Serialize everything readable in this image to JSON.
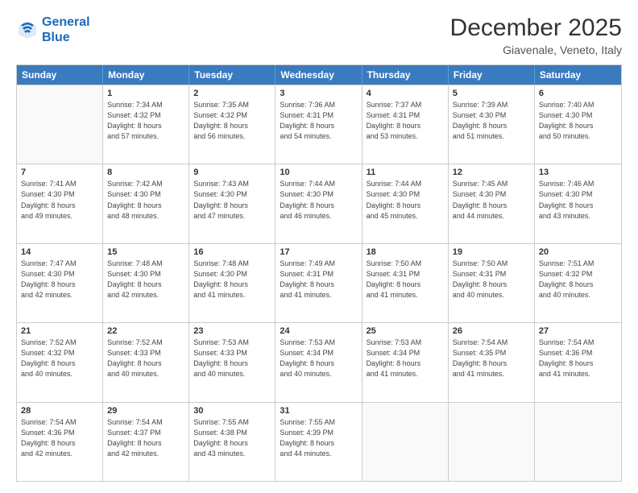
{
  "header": {
    "logo_line1": "General",
    "logo_line2": "Blue",
    "month": "December 2025",
    "location": "Giavenale, Veneto, Italy"
  },
  "weekdays": [
    "Sunday",
    "Monday",
    "Tuesday",
    "Wednesday",
    "Thursday",
    "Friday",
    "Saturday"
  ],
  "rows": [
    [
      {
        "day": "",
        "info": ""
      },
      {
        "day": "1",
        "info": "Sunrise: 7:34 AM\nSunset: 4:32 PM\nDaylight: 8 hours\nand 57 minutes."
      },
      {
        "day": "2",
        "info": "Sunrise: 7:35 AM\nSunset: 4:32 PM\nDaylight: 8 hours\nand 56 minutes."
      },
      {
        "day": "3",
        "info": "Sunrise: 7:36 AM\nSunset: 4:31 PM\nDaylight: 8 hours\nand 54 minutes."
      },
      {
        "day": "4",
        "info": "Sunrise: 7:37 AM\nSunset: 4:31 PM\nDaylight: 8 hours\nand 53 minutes."
      },
      {
        "day": "5",
        "info": "Sunrise: 7:39 AM\nSunset: 4:30 PM\nDaylight: 8 hours\nand 51 minutes."
      },
      {
        "day": "6",
        "info": "Sunrise: 7:40 AM\nSunset: 4:30 PM\nDaylight: 8 hours\nand 50 minutes."
      }
    ],
    [
      {
        "day": "7",
        "info": "Sunrise: 7:41 AM\nSunset: 4:30 PM\nDaylight: 8 hours\nand 49 minutes."
      },
      {
        "day": "8",
        "info": "Sunrise: 7:42 AM\nSunset: 4:30 PM\nDaylight: 8 hours\nand 48 minutes."
      },
      {
        "day": "9",
        "info": "Sunrise: 7:43 AM\nSunset: 4:30 PM\nDaylight: 8 hours\nand 47 minutes."
      },
      {
        "day": "10",
        "info": "Sunrise: 7:44 AM\nSunset: 4:30 PM\nDaylight: 8 hours\nand 46 minutes."
      },
      {
        "day": "11",
        "info": "Sunrise: 7:44 AM\nSunset: 4:30 PM\nDaylight: 8 hours\nand 45 minutes."
      },
      {
        "day": "12",
        "info": "Sunrise: 7:45 AM\nSunset: 4:30 PM\nDaylight: 8 hours\nand 44 minutes."
      },
      {
        "day": "13",
        "info": "Sunrise: 7:46 AM\nSunset: 4:30 PM\nDaylight: 8 hours\nand 43 minutes."
      }
    ],
    [
      {
        "day": "14",
        "info": "Sunrise: 7:47 AM\nSunset: 4:30 PM\nDaylight: 8 hours\nand 42 minutes."
      },
      {
        "day": "15",
        "info": "Sunrise: 7:48 AM\nSunset: 4:30 PM\nDaylight: 8 hours\nand 42 minutes."
      },
      {
        "day": "16",
        "info": "Sunrise: 7:48 AM\nSunset: 4:30 PM\nDaylight: 8 hours\nand 41 minutes."
      },
      {
        "day": "17",
        "info": "Sunrise: 7:49 AM\nSunset: 4:31 PM\nDaylight: 8 hours\nand 41 minutes."
      },
      {
        "day": "18",
        "info": "Sunrise: 7:50 AM\nSunset: 4:31 PM\nDaylight: 8 hours\nand 41 minutes."
      },
      {
        "day": "19",
        "info": "Sunrise: 7:50 AM\nSunset: 4:31 PM\nDaylight: 8 hours\nand 40 minutes."
      },
      {
        "day": "20",
        "info": "Sunrise: 7:51 AM\nSunset: 4:32 PM\nDaylight: 8 hours\nand 40 minutes."
      }
    ],
    [
      {
        "day": "21",
        "info": "Sunrise: 7:52 AM\nSunset: 4:32 PM\nDaylight: 8 hours\nand 40 minutes."
      },
      {
        "day": "22",
        "info": "Sunrise: 7:52 AM\nSunset: 4:33 PM\nDaylight: 8 hours\nand 40 minutes."
      },
      {
        "day": "23",
        "info": "Sunrise: 7:53 AM\nSunset: 4:33 PM\nDaylight: 8 hours\nand 40 minutes."
      },
      {
        "day": "24",
        "info": "Sunrise: 7:53 AM\nSunset: 4:34 PM\nDaylight: 8 hours\nand 40 minutes."
      },
      {
        "day": "25",
        "info": "Sunrise: 7:53 AM\nSunset: 4:34 PM\nDaylight: 8 hours\nand 41 minutes."
      },
      {
        "day": "26",
        "info": "Sunrise: 7:54 AM\nSunset: 4:35 PM\nDaylight: 8 hours\nand 41 minutes."
      },
      {
        "day": "27",
        "info": "Sunrise: 7:54 AM\nSunset: 4:36 PM\nDaylight: 8 hours\nand 41 minutes."
      }
    ],
    [
      {
        "day": "28",
        "info": "Sunrise: 7:54 AM\nSunset: 4:36 PM\nDaylight: 8 hours\nand 42 minutes."
      },
      {
        "day": "29",
        "info": "Sunrise: 7:54 AM\nSunset: 4:37 PM\nDaylight: 8 hours\nand 42 minutes."
      },
      {
        "day": "30",
        "info": "Sunrise: 7:55 AM\nSunset: 4:38 PM\nDaylight: 8 hours\nand 43 minutes."
      },
      {
        "day": "31",
        "info": "Sunrise: 7:55 AM\nSunset: 4:39 PM\nDaylight: 8 hours\nand 44 minutes."
      },
      {
        "day": "",
        "info": ""
      },
      {
        "day": "",
        "info": ""
      },
      {
        "day": "",
        "info": ""
      }
    ]
  ]
}
